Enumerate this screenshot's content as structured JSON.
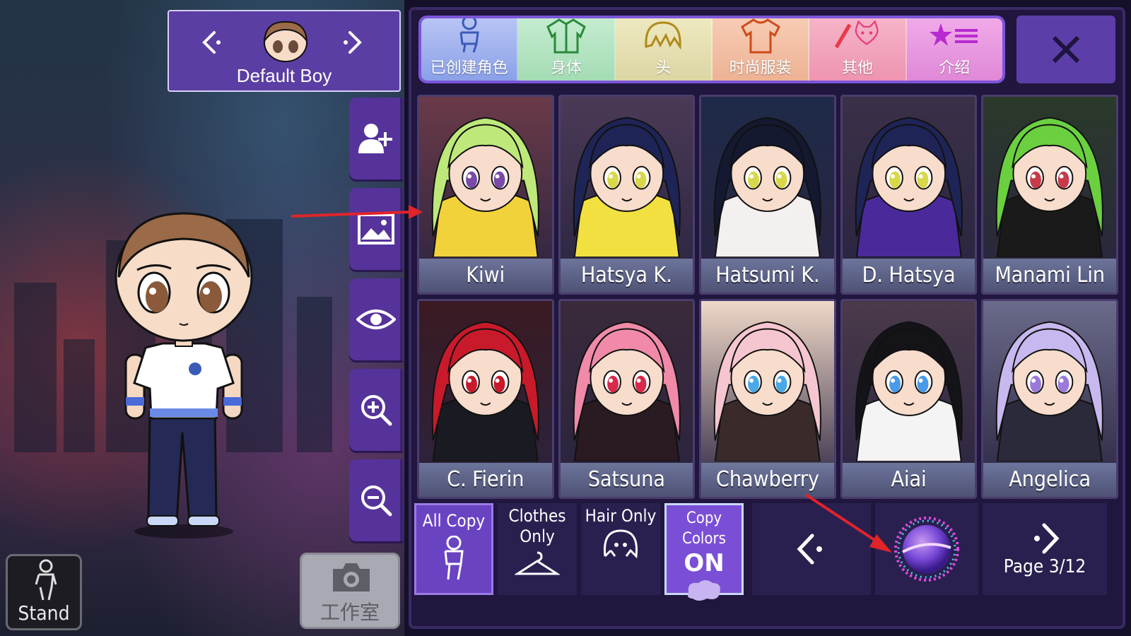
{
  "character_selector": {
    "name": "Default Boy"
  },
  "side_buttons": [
    {
      "icon": "add-person-icon"
    },
    {
      "icon": "background-image-icon"
    },
    {
      "icon": "eye-icon"
    },
    {
      "icon": "zoom-in-icon"
    },
    {
      "icon": "zoom-out-icon"
    }
  ],
  "studio_button": {
    "label": "工作室",
    "icon": "camera-icon"
  },
  "stand_button": {
    "label": "Stand",
    "icon": "pose-figure-icon"
  },
  "tabs": [
    {
      "label": "已创建角色",
      "icon": "character-outline-icon",
      "color": "#a8b8f0"
    },
    {
      "label": "身体",
      "icon": "jacket-icon",
      "color": "#a8e0b8"
    },
    {
      "label": "头",
      "icon": "hair-icon",
      "color": "#e6e0a8"
    },
    {
      "label": "时尚服装",
      "icon": "tshirt-icon",
      "color": "#f2b898"
    },
    {
      "label": "其他",
      "icon": "sword-cat-icon",
      "color": "#f298b0"
    },
    {
      "label": "介绍",
      "icon": "star-list-icon",
      "color": "#e88ad8"
    }
  ],
  "close_button": {
    "icon": "close-icon"
  },
  "characters": [
    {
      "name": "Kiwi",
      "hair": "#bfe87a",
      "outfit": "#f2d23a",
      "eyes": "#7a4aa8",
      "bg": "#6a3a48"
    },
    {
      "name": "Hatsya K.",
      "hair": "#1e2456",
      "outfit": "#f2e040",
      "eyes": "#d8d84a",
      "bg": "#4a3a56"
    },
    {
      "name": "Hatsumi K.",
      "hair": "#141830",
      "outfit": "#f4f0f0",
      "eyes": "#d8d84a",
      "bg": "#1e2a48"
    },
    {
      "name": "D. Hatsya",
      "hair": "#1e2456",
      "outfit": "#4a2a9a",
      "eyes": "#d8d84a",
      "bg": "#3a3048"
    },
    {
      "name": "Manami Lin",
      "hair": "#6ad040",
      "outfit": "#1a1a1a",
      "eyes": "#c83a4a",
      "bg": "#2a3a2a"
    },
    {
      "name": "C. Fierin",
      "hair": "#c81a2a",
      "outfit": "#1a1a22",
      "eyes": "#c81a2a",
      "bg": "#3a1a22"
    },
    {
      "name": "Satsuna",
      "hair": "#f08aa8",
      "outfit": "#2a1a22",
      "eyes": "#d82a4a",
      "bg": "#3a2a3a"
    },
    {
      "name": "Chawberry",
      "hair": "#f6c6d0",
      "outfit": "#3a2a2a",
      "eyes": "#4aa8e8",
      "bg": "#f0d8c8"
    },
    {
      "name": "Aiai",
      "hair": "#141418",
      "outfit": "#f4f4f4",
      "eyes": "#4a9ae8",
      "bg": "#4a3a4a"
    },
    {
      "name": "Angelica",
      "hair": "#c8b8f0",
      "outfit": "#2a2a3a",
      "eyes": "#9a7ad8",
      "bg": "#6a6a8a"
    }
  ],
  "copy_options": [
    {
      "label": "All Copy",
      "icon": "full-body-icon",
      "selected": true
    },
    {
      "label": "Clothes Only",
      "icon": "hanger-icon",
      "selected": false
    },
    {
      "label": "Hair Only",
      "icon": "hair-outline-icon",
      "selected": false
    },
    {
      "label": "Copy Colors",
      "state": "ON",
      "icon": "paint-splash-icon",
      "selected": true
    }
  ],
  "pagination": {
    "prev_icon": "chevron-left-icon",
    "next_icon": "chevron-right-icon",
    "page": "Page 3/12"
  },
  "planet_button": {
    "icon": "planet-icon"
  },
  "colors": {
    "panel_purple": "#5b3ea3",
    "accent_purple": "#7b55d9",
    "annotation_red": "#e0242a"
  }
}
